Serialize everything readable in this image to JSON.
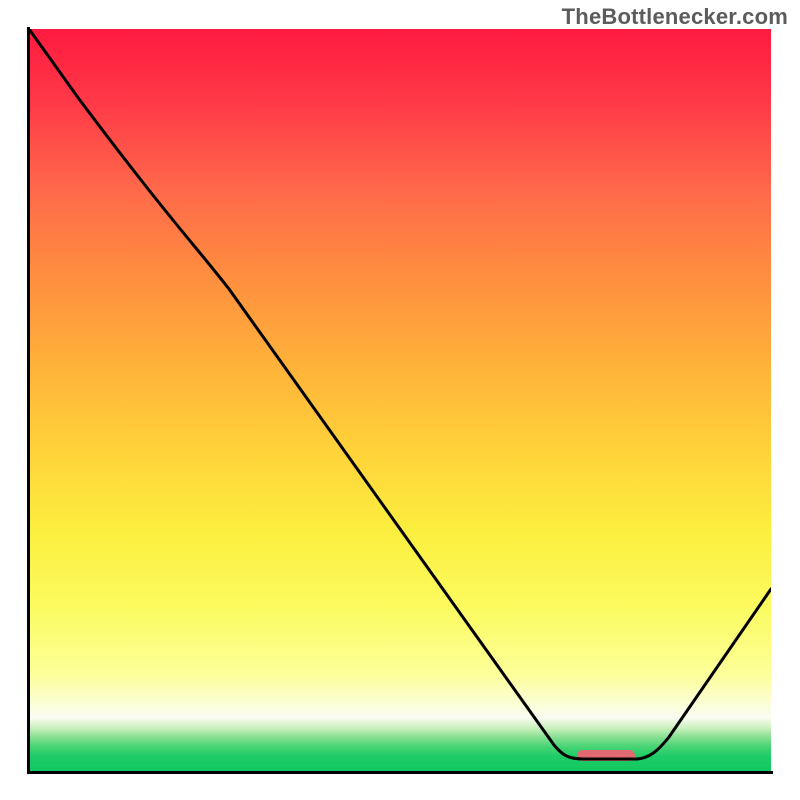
{
  "watermark": "TheBottlenecker.com",
  "chart_data": {
    "type": "line",
    "title": "",
    "xlabel": "",
    "ylabel": "",
    "xlim": [
      0,
      100
    ],
    "ylim": [
      0,
      100
    ],
    "note": "No tick labels are visible; x/y values are estimated from pixel positions on a 0–100 normalized scale.",
    "series": [
      {
        "name": "bottleneck-curve",
        "x": [
          0,
          7,
          27,
          71,
          74,
          82,
          86,
          100
        ],
        "y": [
          100,
          91,
          65,
          3.5,
          1.6,
          1.6,
          4.6,
          24.5
        ]
      }
    ],
    "marker": {
      "name": "optimal-range",
      "x_range": [
        74,
        82
      ],
      "y": 2.8,
      "color": "#e16a72"
    },
    "background_gradient": {
      "direction": "vertical",
      "stops": [
        {
          "pos": 0,
          "color": "#ff1a3f"
        },
        {
          "pos": 0.33,
          "color": "#ff8d3f"
        },
        {
          "pos": 0.68,
          "color": "#fcef3f"
        },
        {
          "pos": 0.92,
          "color": "#fafcf2"
        },
        {
          "pos": 1.0,
          "color": "#12c85f"
        }
      ]
    }
  }
}
